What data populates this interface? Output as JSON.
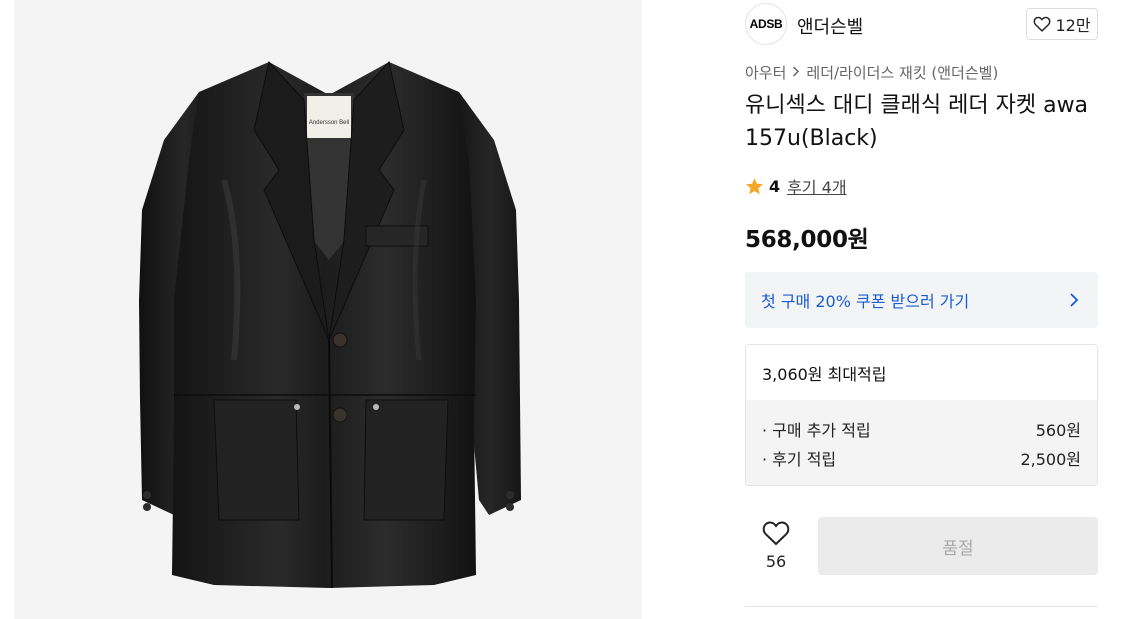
{
  "product_image": {
    "alt_icon": "leather-jacket-image",
    "label_text": "Andersson Bell"
  },
  "brand": {
    "logo_text": "ADSB",
    "name": "앤더슨벨",
    "like_count": "12만"
  },
  "breadcrumb": {
    "level1": "아우터",
    "level2": "레더/라이더스 재킷 (앤더슨벨)"
  },
  "product": {
    "title": "유니섹스 대디 클래식 레더 자켓 awa157u(Black)",
    "rating": "4",
    "review_link": "후기 4개",
    "price": "568,000원"
  },
  "coupon": {
    "text": "첫 구매 20% 쿠폰 받으러 가기"
  },
  "points": {
    "max_label": "3,060원 최대적립",
    "items": [
      {
        "label": "· 구매 추가 적립",
        "value": "560원"
      },
      {
        "label": "· 후기 적립",
        "value": "2,500원"
      }
    ]
  },
  "actions": {
    "wish_count": "56",
    "soldout_label": "품절"
  },
  "colors": {
    "coupon_text": "#1a5bd6",
    "star": "#f5a623",
    "soldout_bg": "#ebebeb"
  }
}
